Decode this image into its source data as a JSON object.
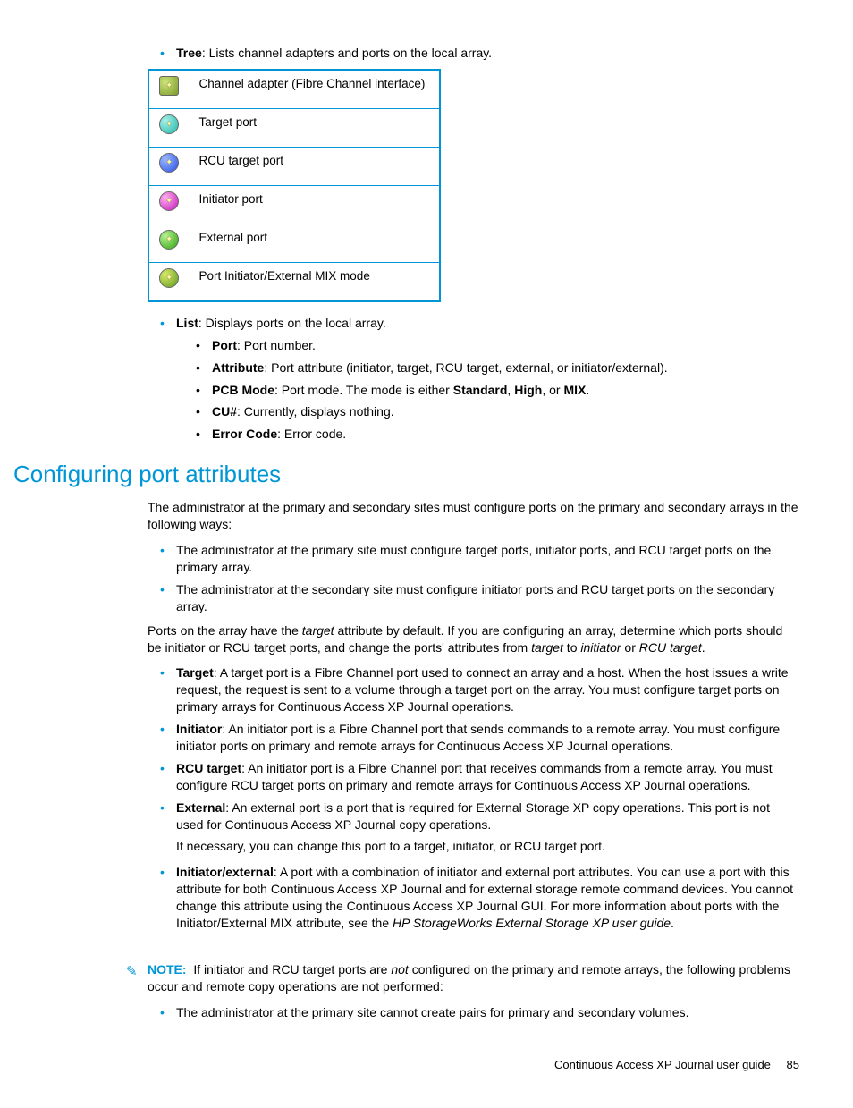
{
  "tree_bullet": {
    "label": "Tree",
    "desc": ": Lists channel adapters and ports on the local array."
  },
  "icon_table": [
    {
      "name": "channel-adapter-icon",
      "desc": "Channel adapter (Fibre Channel interface)"
    },
    {
      "name": "target-port-icon",
      "desc": "Target port"
    },
    {
      "name": "rcu-target-port-icon",
      "desc": "RCU target port"
    },
    {
      "name": "initiator-port-icon",
      "desc": "Initiator port"
    },
    {
      "name": "external-port-icon",
      "desc": "External port"
    },
    {
      "name": "mix-mode-port-icon",
      "desc": "Port Initiator/External MIX mode"
    }
  ],
  "list_bullet": {
    "label": "List",
    "desc": ": Displays ports on the local array.",
    "items": [
      {
        "label": "Port",
        "desc": ": Port number."
      },
      {
        "label": "Attribute",
        "desc": ": Port attribute (initiator, target, RCU target, external, or initiator/external)."
      },
      {
        "label": "PCB Mode",
        "pre": ": Port mode. The mode is either ",
        "b1": "Standard",
        "m1": ", ",
        "b2": "High",
        "m2": ", or ",
        "b3": "MIX",
        "post": "."
      },
      {
        "label": "CU#",
        "desc": ": Currently, displays nothing."
      },
      {
        "label": "Error Code",
        "desc": ": Error code."
      }
    ]
  },
  "section_heading": "Configuring port attributes",
  "intro": "The administrator at the primary and secondary sites must configure ports on the primary and secondary arrays in the following ways:",
  "admin_bullets": [
    "The administrator at the primary site must configure target ports, initiator ports, and RCU target ports on the primary array.",
    "The administrator at the secondary site must configure initiator ports and RCU target ports on the secondary array."
  ],
  "ports_para": {
    "p1": "Ports on the array have the ",
    "i1": "target",
    "p2": " attribute by default. If you are configuring an array, determine which ports should be initiator or RCU target ports, and change the ports' attributes from ",
    "i2": "target",
    "p3": " to ",
    "i3": "initiator",
    "p4": " or ",
    "i4": "RCU target",
    "p5": "."
  },
  "port_types": {
    "target": {
      "label": "Target",
      "desc": ": A target port is a Fibre Channel port used to connect an array and a host. When the host issues a write request, the request is sent to a volume through a target port on the array. You must configure target ports on primary arrays for Continuous Access XP Journal operations."
    },
    "initiator": {
      "label": "Initiator",
      "desc": ": An initiator port is a Fibre Channel port that sends commands to a remote array. You must configure initiator ports on primary and remote arrays for Continuous Access XP Journal operations."
    },
    "rcu": {
      "label": "RCU target",
      "desc": ": An initiator port is a Fibre Channel port that receives commands from a remote array. You must configure RCU target ports on primary and remote arrays for Continuous Access XP Journal operations."
    },
    "external": {
      "label": "External",
      "desc": ": An external port is a port that is required for External Storage XP copy operations. This port is not used for Continuous Access XP Journal copy operations.",
      "extra": "If necessary, you can change this port to a target, initiator, or RCU target port."
    },
    "initext": {
      "label": "Initiator/external",
      "desc_pre": ": A port with a combination of initiator and external port attributes. You can use a port with this attribute for both Continuous Access XP Journal and for external storage remote command devices. You cannot change this attribute using the Continuous Access XP Journal GUI. For more information about ports with the Initiator/External MIX attribute, see the ",
      "desc_italic": "HP StorageWorks External Storage XP user guide",
      "desc_post": "."
    }
  },
  "note": {
    "label": "NOTE:",
    "pre": "If initiator and RCU target ports are ",
    "not": "not",
    "post": " configured on the primary and remote arrays, the following problems occur and remote copy operations are not performed:",
    "bullet": "The administrator at the primary site cannot create pairs for primary and secondary volumes."
  },
  "footer": {
    "title": "Continuous Access XP Journal user guide",
    "page": "85"
  }
}
